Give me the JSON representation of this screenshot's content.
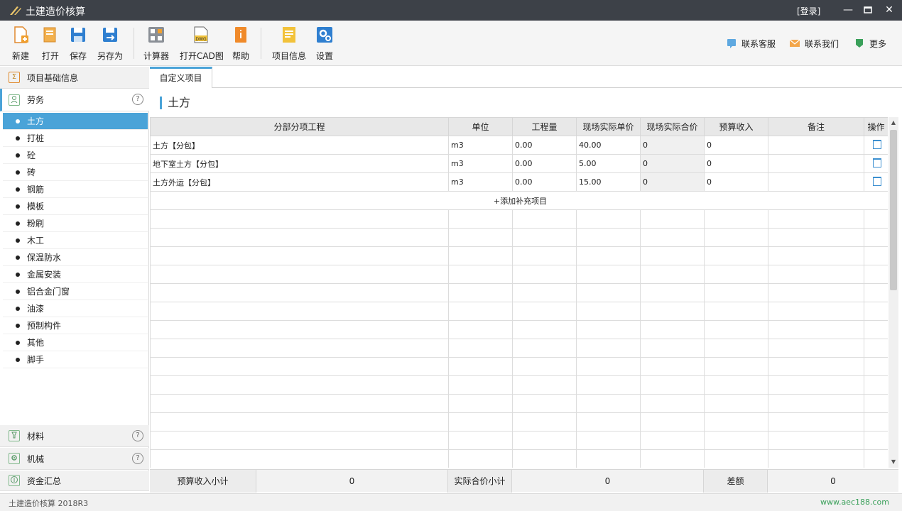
{
  "app": {
    "title": "土建造价核算",
    "login": "[登录]"
  },
  "toolbar": {
    "buttons": [
      {
        "label": "新建",
        "icon": "new-file-icon"
      },
      {
        "label": "打开",
        "icon": "open-folder-icon"
      },
      {
        "label": "保存",
        "icon": "save-icon"
      },
      {
        "label": "另存为",
        "icon": "save-as-icon"
      },
      {
        "label": "计算器",
        "icon": "calculator-icon"
      },
      {
        "label": "打开CAD图",
        "icon": "dwg-icon"
      },
      {
        "label": "帮助",
        "icon": "help-book-icon"
      },
      {
        "label": "项目信息",
        "icon": "project-info-icon"
      },
      {
        "label": "设置",
        "icon": "settings-icon"
      }
    ],
    "dwg_badge": "DWG",
    "right": [
      {
        "label": "联系客服",
        "icon": "support-icon"
      },
      {
        "label": "联系我们",
        "icon": "mail-icon"
      },
      {
        "label": "更多",
        "icon": "more-icon"
      }
    ]
  },
  "sidebar": {
    "sections": {
      "basic": "项目基础信息",
      "labor": "劳务",
      "material": "材料",
      "machine": "机械",
      "funds": "资金汇总"
    },
    "basic_icon": "Σ",
    "help_glyph": "?",
    "items": [
      "土方",
      "打桩",
      "砼",
      "砖",
      "钢筋",
      "模板",
      "粉刷",
      "木工",
      "保温防水",
      "金属安装",
      "铝合金门窗",
      "油漆",
      "预制构件",
      "其他",
      "脚手"
    ]
  },
  "tabs": [
    "自定义项目"
  ],
  "section_title": "土方",
  "table": {
    "headers": [
      "分部分项工程",
      "单位",
      "工程量",
      "现场实际单价",
      "现场实际合价",
      "预算收入",
      "备注",
      "操作"
    ],
    "rows": [
      {
        "name": "土方【分包】",
        "unit": "m3",
        "qty": "0.00",
        "price": "40.00",
        "total": "0",
        "budget": "0",
        "note": ""
      },
      {
        "name": "地下室土方【分包】",
        "unit": "m3",
        "qty": "0.00",
        "price": "5.00",
        "total": "0",
        "budget": "0",
        "note": ""
      },
      {
        "name": "土方外运【分包】",
        "unit": "m3",
        "qty": "0.00",
        "price": "15.00",
        "total": "0",
        "budget": "0",
        "note": ""
      }
    ],
    "add_row": "+添加补充项目"
  },
  "summary": {
    "budget_label": "预算收入小计",
    "budget_value": "0",
    "actual_label": "实际合价小计",
    "actual_value": "0",
    "diff_label": "差额",
    "diff_value": "0"
  },
  "status": {
    "version": "土建造价核算  2018R3",
    "url": "www.aec188.com"
  },
  "colors": {
    "accent": "#4aa3d8",
    "titlebar": "#3d4148",
    "link_green": "#3aa05a"
  }
}
